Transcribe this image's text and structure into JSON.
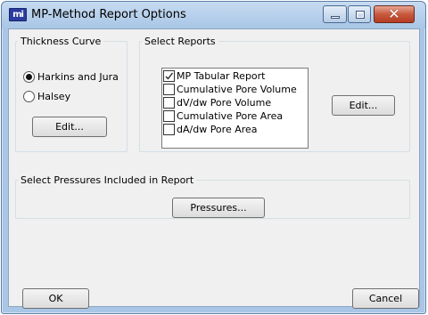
{
  "window": {
    "title": "MP-Method Report Options",
    "icon": "mi-app-icon",
    "icon_text": "mi",
    "controls": {
      "minimize": "minimize-icon",
      "maximize": "maximize-icon",
      "close": "close-icon",
      "close_glyph": "✕"
    }
  },
  "thickness_curve": {
    "legend": "Thickness Curve",
    "options": [
      {
        "label": "Harkins and Jura",
        "selected": true
      },
      {
        "label": "Halsey",
        "selected": false
      }
    ],
    "edit_label": "Edit..."
  },
  "select_reports": {
    "legend": "Select Reports",
    "items": [
      {
        "label": "MP Tabular Report",
        "checked": true
      },
      {
        "label": "Cumulative Pore Volume",
        "checked": false
      },
      {
        "label": "dV/dw Pore Volume",
        "checked": false
      },
      {
        "label": "Cumulative Pore Area",
        "checked": false
      },
      {
        "label": "dA/dw Pore Area",
        "checked": false
      }
    ],
    "edit_label": "Edit..."
  },
  "pressures": {
    "legend": "Select Pressures Included in Report",
    "button_label": "Pressures..."
  },
  "footer": {
    "ok_label": "OK",
    "cancel_label": "Cancel"
  },
  "colors": {
    "frame": "#a9c6e6",
    "close_button": "#c75a3e",
    "dialog_bg": "#f0f0f0"
  }
}
